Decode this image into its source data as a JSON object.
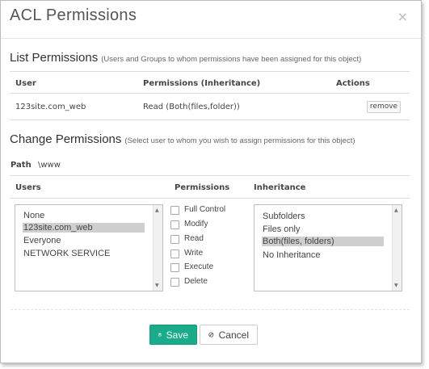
{
  "dialog": {
    "title": "ACL Permissions",
    "close_icon": "×"
  },
  "list_section": {
    "heading": "List Permissions",
    "subheading": "(Users and Groups to whom permissions have been assigned for this object)",
    "columns": [
      "User",
      "Permissions (Inheritance)",
      "Actions"
    ],
    "rows": [
      {
        "user": "123site.com_web",
        "permissions": "Read (Both(files,folder))",
        "action": "remove"
      }
    ]
  },
  "change_section": {
    "heading": "Change Permissions",
    "subheading": "(Select user to whom you wish to assign permissions for this object)",
    "path_label": "Path",
    "path_value": "\\www",
    "users_header": "Users",
    "permissions_header": "Permissions",
    "inheritance_header": "Inheritance",
    "users": [
      "None",
      "123site.com_web",
      "Everyone",
      "NETWORK SERVICE"
    ],
    "selected_user": "123site.com_web",
    "permissions": [
      "Full Control",
      "Modify",
      "Read",
      "Write",
      "Execute",
      "Delete"
    ],
    "inheritance": [
      "Subfolders",
      "Files only",
      "Both(files, folders)",
      "No Inheritance"
    ],
    "selected_inheritance": "Both(files, folders)"
  },
  "buttons": {
    "save_label": "Save",
    "cancel_label": "Cancel"
  },
  "colors": {
    "save_bg": "#1aab8a",
    "selection_bg": "#cfcfcf"
  },
  "icons": {
    "save": "floppy-disk-icon",
    "cancel": "ban-icon",
    "close": "close-icon"
  }
}
